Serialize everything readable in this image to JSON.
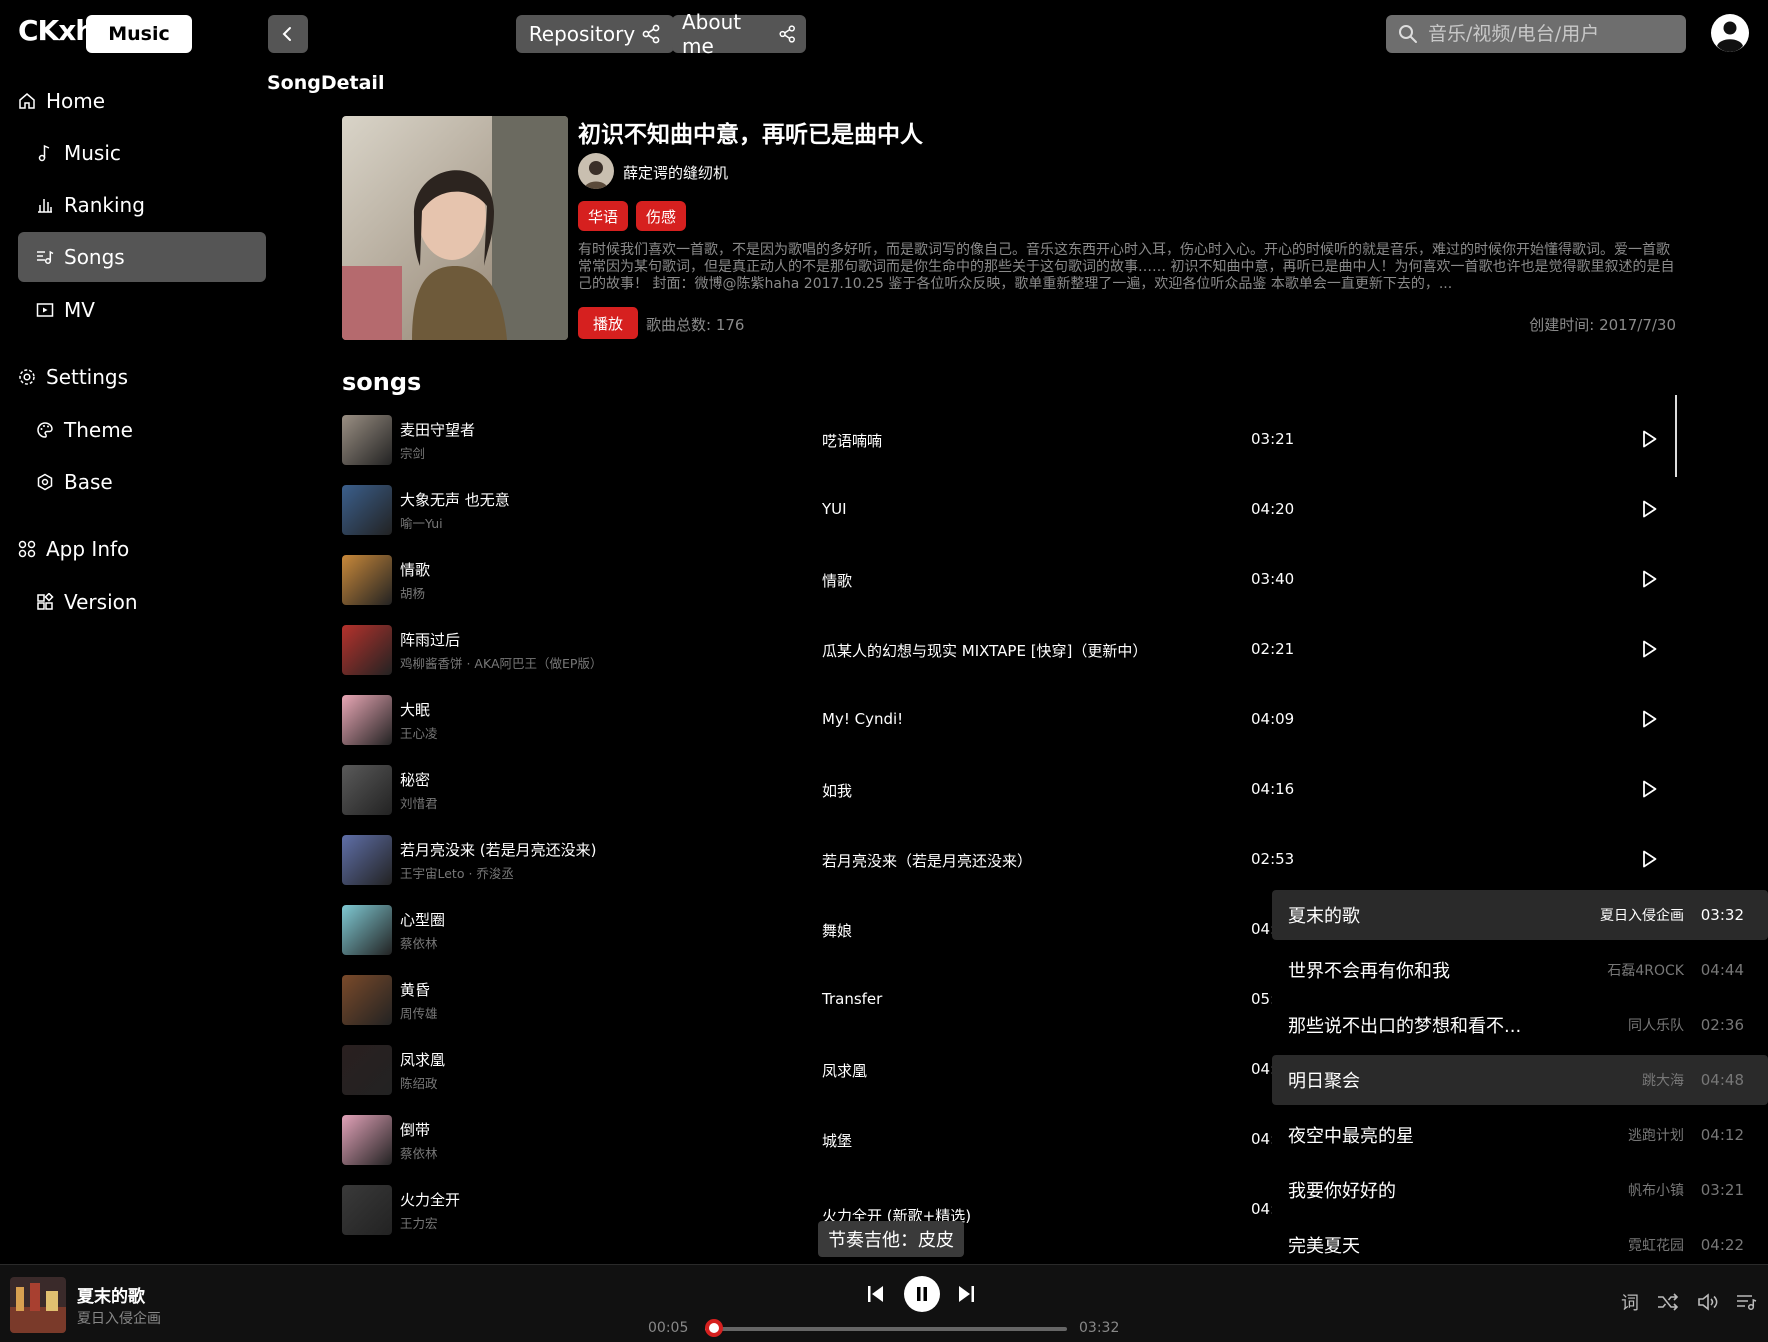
{
  "header": {
    "logo_text": "CKxh",
    "badge": "Music",
    "repo_label": "Repository",
    "about_label": "About me",
    "search_placeholder": "音乐/视频/电台/用户"
  },
  "sidebar": {
    "groups": [
      {
        "label": "Home",
        "icon": "home-icon",
        "items": [
          {
            "label": "Music",
            "icon": "music-note-icon"
          },
          {
            "label": "Ranking",
            "icon": "ranking-icon"
          },
          {
            "label": "Songs",
            "icon": "songs-list-icon",
            "active": true
          },
          {
            "label": "MV",
            "icon": "video-icon"
          }
        ]
      },
      {
        "label": "Settings",
        "icon": "gear-icon",
        "items": [
          {
            "label": "Theme",
            "icon": "palette-icon"
          },
          {
            "label": "Base",
            "icon": "base-settings-icon"
          }
        ]
      },
      {
        "label": "App Info",
        "icon": "apps-icon",
        "items": [
          {
            "label": "Version",
            "icon": "version-icon"
          }
        ]
      }
    ]
  },
  "page": {
    "title": "SongDetail"
  },
  "playlist": {
    "title": "初识不知曲中意，再听已是曲中人",
    "creator": "薛定谔的缝纫机",
    "tags": [
      "华语",
      "伤感"
    ],
    "description": "有时候我们喜欢一首歌，不是因为歌唱的多好听，而是歌词写的像自己。音乐这东西开心时入耳，伤心时入心。开心的时候听的就是音乐，难过的时候你开始懂得歌词。爱一首歌常常因为某句歌词，但是真正动人的不是那句歌词而是你生命中的那些关于这句歌词的故事…… 初识不知曲中意，再听已是曲中人！为何喜欢一首歌也许也是觉得歌里叙述的是自己的故事！ 封面：微博@陈紫haha 2017.10.25 鉴于各位听众反映，歌单重新整理了一遍，欢迎各位听众品鉴 本歌单会一直更新下去的，...",
    "play_label": "播放",
    "count_label": "歌曲总数: 176",
    "created_label": "创建时间: 2017/7/30"
  },
  "songs_heading": "songs",
  "songs": [
    {
      "name": "麦田守望者",
      "artist": "宗剑",
      "album": "呓语喃喃",
      "duration": "03:21",
      "color": "#9a8f83"
    },
    {
      "name": "大象无声 也无意",
      "artist": "喻一Yui",
      "album": "YUI",
      "duration": "04:20",
      "color": "#3b5f8c"
    },
    {
      "name": "情歌",
      "artist": "胡杨",
      "album": "情歌",
      "duration": "03:40",
      "color": "#c8883a"
    },
    {
      "name": "阵雨过后",
      "artist": "鸡柳酱香饼 · AKA阿巴王（做EP版）",
      "album": "瓜某人的幻想与现实 MIXTAPE [快穿]（更新中）",
      "duration": "02:21",
      "color": "#b5322c"
    },
    {
      "name": "大眠",
      "artist": "王心凌",
      "album": "My! Cyndi!",
      "duration": "04:09",
      "color": "#e9a7b5"
    },
    {
      "name": "秘密",
      "artist": "刘惜君",
      "album": "如我",
      "duration": "04:16",
      "color": "#5a5a5a"
    },
    {
      "name": "若月亮没来 (若是月亮还没来)",
      "artist": "王宇宙Leto · 乔浚丞",
      "album": "若月亮没来（若是月亮还没来）",
      "duration": "02:53",
      "color": "#5f6fa8"
    },
    {
      "name": "心型圈",
      "artist": "蔡依林",
      "album": "舞娘",
      "duration": "04:",
      "color": "#7fc9d3"
    },
    {
      "name": "黄昏",
      "artist": "周传雄",
      "album": "Transfer",
      "duration": "05:",
      "color": "#7a4a2a"
    },
    {
      "name": "凤求凰",
      "artist": "陈绍政",
      "album": "凤求凰",
      "duration": "04:",
      "color": "#2a2020"
    },
    {
      "name": "倒带",
      "artist": "蔡依林",
      "album": "城堡",
      "duration": "04:",
      "color": "#e2a2b8"
    },
    {
      "name": "火力全开",
      "artist": "王力宏",
      "album": "火力全开 (新歌+精选)",
      "duration": "04:",
      "color": "#3a3a3a"
    }
  ],
  "queue": [
    {
      "name": "夏末的歌",
      "artist": "夏日入侵企画",
      "duration": "03:32",
      "current": true
    },
    {
      "name": "世界不会再有你和我",
      "artist": "石磊4ROCK",
      "duration": "04:44"
    },
    {
      "name": "那些说不出口的梦想和看不...",
      "artist": "同人乐队",
      "duration": "02:36"
    },
    {
      "name": "明日聚会",
      "artist": "跳大海",
      "duration": "04:48",
      "highlight": true
    },
    {
      "name": "夜空中最亮的星",
      "artist": "逃跑计划",
      "duration": "04:12"
    },
    {
      "name": "我要你好好的",
      "artist": "帆布小镇",
      "duration": "03:21"
    },
    {
      "name": "完美夏天",
      "artist": "霓虹花园",
      "duration": "04:22"
    }
  ],
  "tooltip": "节奏吉他：皮皮",
  "player": {
    "title": "夏末的歌",
    "artist": "夏日入侵企画",
    "current_time": "00:05",
    "total_time": "03:32",
    "progress": 0.024,
    "lyrics_label": "词"
  },
  "colors": {
    "accent": "#d6201f",
    "panel": "#555555",
    "background": "#000000"
  }
}
